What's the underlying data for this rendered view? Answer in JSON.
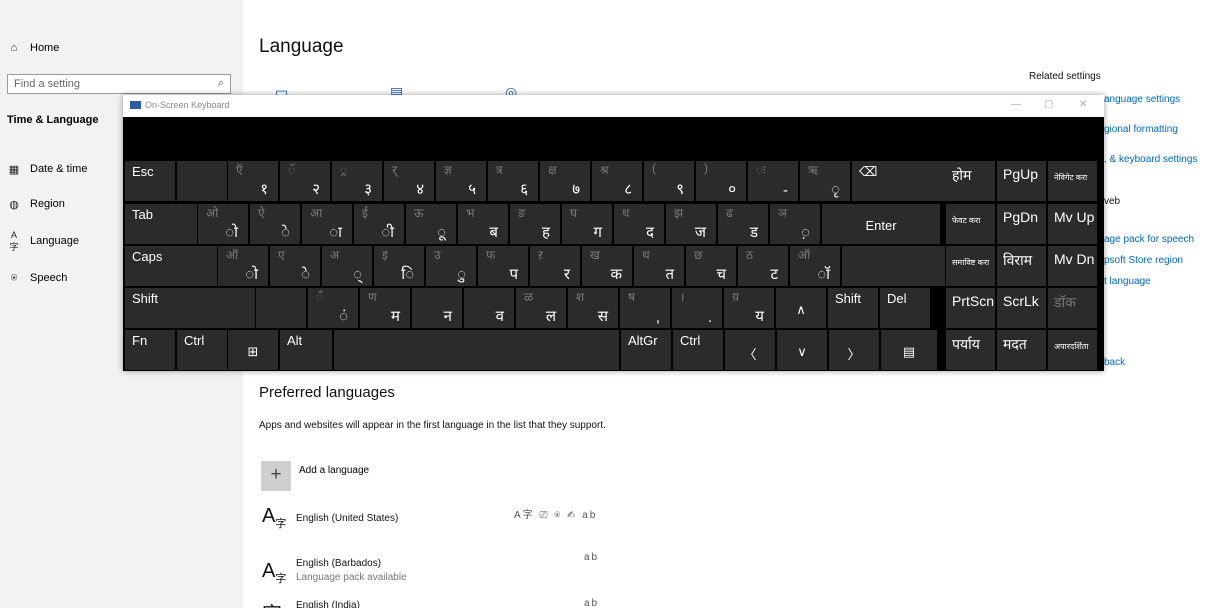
{
  "sidebar": {
    "home_label": "Home",
    "search_placeholder": "Find a setting",
    "section_title": "Time & Language",
    "items": [
      {
        "label": "Date & time",
        "icon": "calendar-clock-icon"
      },
      {
        "label": "Region",
        "icon": "globe-icon"
      },
      {
        "label": "Language",
        "icon": "language-icon"
      },
      {
        "label": "Speech",
        "icon": "microphone-icon"
      }
    ]
  },
  "main": {
    "page_title": "Language",
    "related_title": "Related settings",
    "related_links": [
      "anguage settings",
      "gional formatting",
      ", & keyboard settings",
      "veb",
      "age pack for speech",
      "psoft Store region",
      "t language",
      "back"
    ],
    "preferred": {
      "title": "Preferred languages",
      "description": "Apps and websites will appear in the first language in the list that they support.",
      "add_label": "Add a language",
      "languages": [
        {
          "name": "English (United States)",
          "sub": ""
        },
        {
          "name": "English (Barbados)",
          "sub": "Language pack available"
        },
        {
          "name": "English (India)",
          "sub": ""
        }
      ]
    }
  },
  "osk": {
    "title": "On-Screen Keyboard",
    "row1": {
      "esc": "Esc",
      "keys": [
        [
          "ऍ",
          "१"
        ],
        [
          "ॅ",
          "२"
        ],
        [
          "्र",
          "३"
        ],
        [
          "र्",
          "४"
        ],
        [
          "ज्ञ",
          "५"
        ],
        [
          "त्र",
          "६"
        ],
        [
          "क्ष",
          "७"
        ],
        [
          "श्र",
          "८"
        ],
        [
          "(",
          "९"
        ],
        [
          ")",
          "०"
        ],
        [
          "ः",
          "-"
        ],
        [
          "ऋ",
          "ृ"
        ]
      ],
      "backspace": "⌫"
    },
    "row2": {
      "tab": "Tab",
      "keys": [
        [
          "ओ",
          "ो"
        ],
        [
          "ऐ",
          "े"
        ],
        [
          "आ",
          "ा"
        ],
        [
          "ई",
          "ी"
        ],
        [
          "ऊ",
          "ू"
        ],
        [
          "भ",
          "ब"
        ],
        [
          "ङ",
          "ह"
        ],
        [
          "घ",
          "ग"
        ],
        [
          "ध",
          "द"
        ],
        [
          "झ",
          "ज"
        ],
        [
          "ढ",
          "ड"
        ],
        [
          "ञ",
          "़"
        ]
      ],
      "enter": "Enter"
    },
    "row3": {
      "caps": "Caps",
      "keys": [
        [
          "ऑ",
          "ो"
        ],
        [
          "ए",
          "े"
        ],
        [
          "अ",
          "्"
        ],
        [
          "इ",
          "ि"
        ],
        [
          "उ",
          "ु"
        ],
        [
          "फ",
          "प"
        ],
        [
          "ऱ",
          "र"
        ],
        [
          "ख",
          "क"
        ],
        [
          "थ",
          "त"
        ],
        [
          "छ",
          "च"
        ],
        [
          "ठ",
          "ट"
        ],
        [
          "ऑ",
          "ॉ"
        ]
      ]
    },
    "row4": {
      "shift": "Shift",
      "keys": [
        [
          "ँ",
          "ं"
        ],
        [
          "ण",
          "म"
        ],
        [
          "",
          "न"
        ],
        [
          "",
          "व"
        ],
        [
          "ळ",
          "ल"
        ],
        [
          "श",
          "स"
        ],
        [
          "ष",
          ","
        ],
        [
          "।",
          "."
        ],
        [
          "य़",
          "य"
        ]
      ],
      "shift_r": "Shift",
      "del": "Del"
    },
    "row5": {
      "fn": "Fn",
      "ctrl": "Ctrl",
      "alt": "Alt",
      "altgr": "AltGr",
      "ctrl_r": "Ctrl"
    },
    "side": [
      [
        "होम",
        "PgUp",
        "नेविगेट करा"
      ],
      [
        "फेवट करा",
        "PgDn",
        "Mv Up"
      ],
      [
        "समाविष्ट करा",
        "विराम",
        "Mv Dn"
      ],
      [
        "PrtScn",
        "ScrLk",
        "डॉक"
      ],
      [
        "पर्याय",
        "मदत",
        "अपारदर्शिता"
      ]
    ]
  }
}
